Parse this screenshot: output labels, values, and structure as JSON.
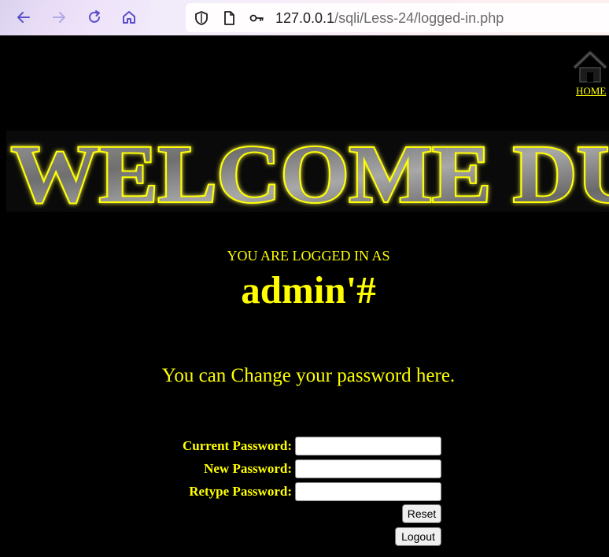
{
  "browser": {
    "url_host": "127.0.0.1",
    "url_path": "/sqli/Less-24/logged-in.php",
    "icons": [
      "back-arrow-icon",
      "forward-arrow-icon",
      "reload-icon",
      "home-icon",
      "shield-icon",
      "page-icon",
      "key-icon"
    ]
  },
  "page": {
    "home_label": "HOME",
    "banner_text": "WELCOME DU",
    "logged_in_label": "YOU ARE LOGGED IN AS",
    "username": "admin'#",
    "change_message": "You can Change your password here.",
    "form": {
      "current_password_label": "Current Password:",
      "new_password_label": "New Password:",
      "retype_password_label": "Retype Password:",
      "current_password_value": "",
      "new_password_value": "",
      "retype_password_value": "",
      "reset_label": "Reset",
      "logout_label": "Logout"
    }
  },
  "colors": {
    "text": "#ffff00",
    "background": "#000000"
  }
}
